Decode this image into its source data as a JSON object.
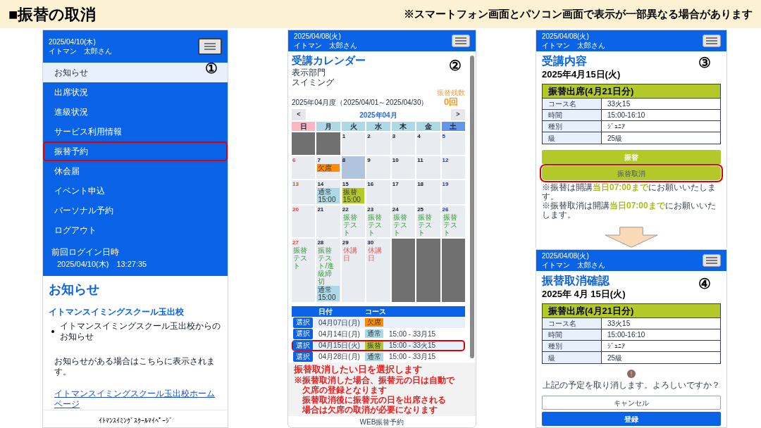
{
  "header": {
    "title": "■振替の取消",
    "note": "※スマートフォン画面とパソコン画面で表示が一部異なる場合があります"
  },
  "screen_1": {
    "step": "①",
    "date": "2025/04/10(木)",
    "user": "イトマン　太郎さん",
    "menu": [
      {
        "label": "お知らせ",
        "selected": true,
        "highlighted": false
      },
      {
        "label": "出席状況",
        "selected": false,
        "highlighted": false
      },
      {
        "label": "進級状況",
        "selected": false,
        "highlighted": false
      },
      {
        "label": "サービス利用情報",
        "selected": false,
        "highlighted": false
      },
      {
        "label": "振替予約",
        "selected": false,
        "highlighted": true
      },
      {
        "label": "休会届",
        "selected": false,
        "highlighted": false
      },
      {
        "label": "イベント申込",
        "selected": false,
        "highlighted": false
      },
      {
        "label": "パーソナル予約",
        "selected": false,
        "highlighted": false
      },
      {
        "label": "ログアウト",
        "selected": false,
        "highlighted": false
      }
    ],
    "last_login_label": "前回ログイン日時",
    "last_login": "2025/04/10(木)　13:27:35",
    "notice_title": "お知らせ",
    "school": "イトマンスイミングスクール玉出校",
    "bullets": [
      "イトマンスイミングスクール玉出校からのお知らせ"
    ],
    "message": "お知らせがある場合はこちらに表示されます。",
    "link": "イトマンスイミングスクール玉出校ホームページ",
    "footer": "ｲﾄﾏﾝｽｲﾐﾝｸﾞｽｸｰﾙﾏｲﾍﾟｰｼﾞ"
  },
  "screen_2": {
    "step": "②",
    "date": "2025/04/08(火)",
    "user": "イトマン　太郎さん",
    "title": "受講カレンダー",
    "department_label": "表示部門",
    "department": "スイミング",
    "period": "2025年04月度（2025/04/01～2025/04/30）",
    "remaining_label": "振替残数",
    "remaining": "0回",
    "calendar": {
      "prev": "<",
      "month": "2025年04月",
      "next": ">",
      "weekdays": [
        "日",
        "月",
        "火",
        "水",
        "木",
        "金",
        "土"
      ],
      "weeks": [
        [
          {
            "kind": "blank"
          },
          {
            "kind": "blank"
          },
          {
            "kind": "day",
            "day": "1",
            "today": false
          },
          {
            "kind": "day",
            "day": "2",
            "today": false
          },
          {
            "kind": "day",
            "day": "3",
            "today": false
          },
          {
            "kind": "day",
            "day": "4",
            "today": false
          },
          {
            "kind": "day",
            "day": "5",
            "today": false
          }
        ],
        [
          {
            "kind": "day",
            "day": "6",
            "today": false
          },
          {
            "kind": "day",
            "day": "7",
            "today": false,
            "events": [
              {
                "kind": "absent",
                "text": "欠席"
              }
            ]
          },
          {
            "kind": "day",
            "day": "8",
            "today": true
          },
          {
            "kind": "day",
            "day": "9",
            "today": false
          },
          {
            "kind": "day",
            "day": "10",
            "today": false
          },
          {
            "kind": "day",
            "day": "11",
            "today": false
          },
          {
            "kind": "day",
            "day": "12",
            "today": false
          }
        ],
        [
          {
            "kind": "day",
            "day": "13",
            "today": false
          },
          {
            "kind": "day",
            "day": "14",
            "today": false,
            "events": [
              {
                "kind": "regular",
                "text": "通常",
                "time": "15:00"
              }
            ]
          },
          {
            "kind": "day",
            "day": "15",
            "today": false,
            "events": [
              {
                "kind": "transfer",
                "text": "振替",
                "time": "15:00"
              }
            ]
          },
          {
            "kind": "day",
            "day": "16",
            "today": false
          },
          {
            "kind": "day",
            "day": "17",
            "today": false
          },
          {
            "kind": "day",
            "day": "18",
            "today": false
          },
          {
            "kind": "day",
            "day": "19",
            "today": false
          }
        ],
        [
          {
            "kind": "day",
            "day": "20",
            "today": false
          },
          {
            "kind": "day",
            "day": "21",
            "today": false
          },
          {
            "kind": "day",
            "day": "22",
            "today": false,
            "events": [
              {
                "kind": "test",
                "text": "振替テスト"
              }
            ]
          },
          {
            "kind": "day",
            "day": "23",
            "today": false,
            "events": [
              {
                "kind": "test",
                "text": "振替テスト"
              }
            ]
          },
          {
            "kind": "day",
            "day": "24",
            "today": false,
            "events": [
              {
                "kind": "test",
                "text": "振替テスト"
              }
            ]
          },
          {
            "kind": "day",
            "day": "25",
            "today": false,
            "events": [
              {
                "kind": "test",
                "text": "振替テスト"
              }
            ]
          },
          {
            "kind": "day",
            "day": "26",
            "today": false,
            "events": [
              {
                "kind": "test",
                "text": "振替テスト"
              }
            ]
          }
        ],
        [
          {
            "kind": "day",
            "day": "27",
            "today": false,
            "events": [
              {
                "kind": "test",
                "text": "振替テスト"
              }
            ]
          },
          {
            "kind": "day",
            "day": "28",
            "today": false,
            "events": [
              {
                "kind": "test",
                "text": "振替テスト/進級締切"
              },
              {
                "kind": "regular",
                "text": "通常",
                "time": "15:00"
              }
            ]
          },
          {
            "kind": "day",
            "day": "29",
            "today": false,
            "events": [
              {
                "kind": "closed",
                "text": "休講日"
              }
            ]
          },
          {
            "kind": "day",
            "day": "30",
            "today": false,
            "events": [
              {
                "kind": "closed",
                "text": "休講日"
              }
            ]
          },
          {
            "kind": "blank"
          },
          {
            "kind": "blank"
          },
          {
            "kind": "blank"
          }
        ]
      ]
    },
    "list": {
      "columns": [
        "日付",
        "コース"
      ],
      "rows": [
        {
          "button": "選択",
          "date": "04月07日(月)",
          "badge": {
            "kind": "absent",
            "text": "欠席"
          },
          "highlighted": false
        },
        {
          "button": "選択",
          "date": "04月14日(月)",
          "badge": {
            "kind": "regular",
            "text": "通常"
          },
          "time": "15:00 - 33月15",
          "highlighted": false
        },
        {
          "button": "選択",
          "date": "04月15日(火)",
          "badge": {
            "kind": "transfer",
            "text": "振替"
          },
          "time": "15:00 - 33火15",
          "highlighted": true
        },
        {
          "button": "選択",
          "date": "04月28日(月)",
          "badge": {
            "kind": "regular",
            "text": "通常"
          },
          "time": "15:00 - 33月15",
          "highlighted": false
        }
      ]
    },
    "note": {
      "heading": "振替取消したい日を選択します",
      "lines": [
        "※振替取消した場合、振替元の日は自動で",
        "欠席の登録となります",
        "振替取消後に振替元の日を出席される",
        "場合は欠席の取消が必要になります"
      ]
    },
    "footer": "WEB振替予約"
  },
  "screen_3": {
    "step": "③",
    "date": "2025/04/08(火)",
    "user": "イトマン　太郎さん",
    "title": "受講内容",
    "lesson_date": "2025年4月15日(火)",
    "table": {
      "heading": "振替出席(4月21日分)",
      "rows": [
        {
          "label": "コース名",
          "value": "33火15"
        },
        {
          "label": "時間",
          "value": "15:00-16:10"
        },
        {
          "label": "種別",
          "value": "ｼﾞｭﾆｱ"
        },
        {
          "label": "級",
          "value": "25級"
        }
      ]
    },
    "buttons": [
      {
        "label": "振替",
        "kind": "primary",
        "highlighted": false
      },
      {
        "label": "振替取消",
        "kind": "secondary",
        "highlighted": true
      }
    ],
    "notes": [
      {
        "before": "※振替は開講",
        "emphasis": "当日07:00まで",
        "after": "にお願いいたします。"
      },
      {
        "before": "※振替取消は開講",
        "emphasis": "当日07:00まで",
        "after": "にお願いいたします。"
      }
    ]
  },
  "screen_4": {
    "step": "④",
    "date": "2025/04/08(火)",
    "user": "イトマン　太郎さん",
    "title": "振替取消確認",
    "lesson_date": "2025年 4月 15日(火)",
    "table": {
      "heading": "振替出席(4月21日分)",
      "rows": [
        {
          "label": "コース名",
          "value": "33火15"
        },
        {
          "label": "時間",
          "value": "15:00-16:10"
        },
        {
          "label": "種別",
          "value": "ｼﾞｭﾆｱ"
        },
        {
          "label": "級",
          "value": "25級"
        }
      ]
    },
    "message": "上記の予定を取り消します。よろしいですか？",
    "buttons": [
      {
        "label": "キャンセル",
        "kind": "outline"
      },
      {
        "label": "登録",
        "kind": "primary"
      }
    ]
  }
}
